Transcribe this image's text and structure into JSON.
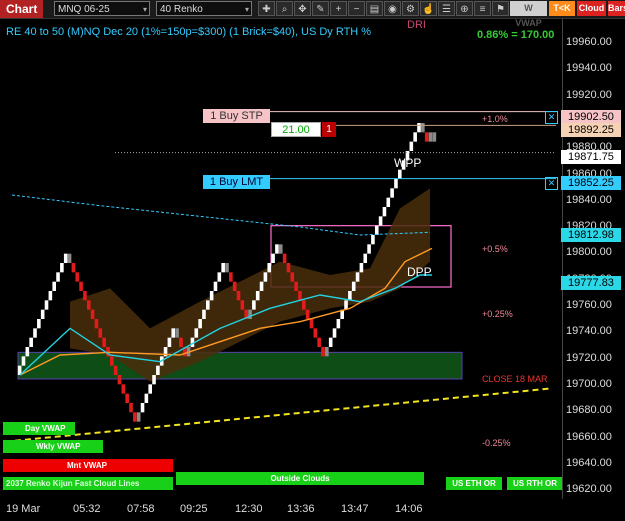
{
  "toolbar": {
    "title": "Chart",
    "instrument": "MNQ 06-25",
    "period": "40 Renko",
    "wvwap": "W VWAP",
    "tok": "T<K",
    "cloud": "Cloud",
    "bars": "Bars",
    "icons": [
      "crosshair-icon",
      "zoom-icon",
      "pan-icon",
      "draw-icon",
      "plus-icon",
      "minus-icon",
      "template-icon",
      "camera-icon",
      "settings-icon",
      "hand-icon",
      "properties-icon",
      "target-icon"
    ]
  },
  "chart": {
    "title": "RE 40 to 50 (M)NQ Dec 20 (1%=150p=$300) (1 Brick=$40), US Dy RTH %",
    "change": "0.86% = 170.00",
    "dri": "DRI",
    "pct_labels": [
      "+1.0%",
      "+0.5%",
      "+0.25%",
      "CLOSE 18 MAR",
      "-0.25%"
    ],
    "wpp": "WPP",
    "dpp": "DPP",
    "orders": {
      "buy_stp": "1 Buy STP",
      "buy_lmt": "1 Buy LMT",
      "qty": "21.00",
      "count": "1"
    },
    "buttons": {
      "day_vwap": "Day VWAP",
      "wkly_vwap": "Wkly VWAP",
      "mnt_vwap": "Mnt VWAP",
      "lines": "2037 Renko Kijun Fast Cloud Lines",
      "outside_clouds": "Outside Clouds",
      "us_eth": "US ETH OR",
      "us_rth": "US RTH OR"
    }
  },
  "axis": {
    "ticks": [
      "19960.00",
      "19940.00",
      "19920.00",
      "19900.00",
      "19880.00",
      "19860.00",
      "19840.00",
      "19820.00",
      "19800.00",
      "19780.00",
      "19760.00",
      "19740.00",
      "19720.00",
      "19700.00",
      "19680.00",
      "19660.00",
      "19640.00",
      "19620.00"
    ],
    "boxes": {
      "buy_stp": "19902.50",
      "last_high": "19892.25",
      "last": "19871.75",
      "buy_lmt": "19852.25",
      "cloud1": "19812.98",
      "cloud2": "19777.83"
    },
    "time": [
      "19 Mar",
      "05:32",
      "07:58",
      "09:25",
      "12:30",
      "13:36",
      "13:47",
      "14:06"
    ]
  },
  "chart_data": {
    "type": "candlestick",
    "title": "RE 40 to 50 (M)NQ Dec 20 (1%=150p=$300) (1 Brick=$40), US Dy RTH %",
    "ylim": [
      19612,
      19972
    ],
    "series": [
      {
        "name": "Renko bricks",
        "close": [
          19705,
          19712,
          19719,
          19726,
          19733,
          19740,
          19747,
          19754,
          19761,
          19768,
          19775,
          19782,
          19789,
          19796,
          19789,
          19782,
          19775,
          19768,
          19761,
          19754,
          19747,
          19740,
          19733,
          19726,
          19719,
          19712,
          19705,
          19698,
          19691,
          19684,
          19677,
          19670,
          19677,
          19684,
          19691,
          19698,
          19705,
          19712,
          19719,
          19726,
          19733,
          19740,
          19733,
          19726,
          19719,
          19726,
          19733,
          19740,
          19747,
          19754,
          19761,
          19768,
          19775,
          19782,
          19789,
          19782,
          19775,
          19768,
          19761,
          19754,
          19747,
          19754,
          19761,
          19768,
          19775,
          19782,
          19789,
          19796,
          19803,
          19796,
          19789,
          19782,
          19775,
          19768,
          19761,
          19754,
          19747,
          19740,
          19733,
          19726,
          19719,
          19726,
          19733,
          19740,
          19747,
          19754,
          19761,
          19768,
          19775,
          19782,
          19789,
          19796,
          19803,
          19810,
          19817,
          19824,
          19831,
          19838,
          19845,
          19852,
          19859,
          19866,
          19873,
          19880,
          19887,
          19894,
          19887,
          19880,
          19887,
          19880
        ],
        "colors_note": "white up, red down, gray transition"
      }
    ],
    "levels": {
      "buy_stp": 19902.5,
      "last": 19871.75,
      "buy_lmt": 19852.25,
      "cloud_upper": 19812.98,
      "cloud_lower": 19777.83
    }
  }
}
